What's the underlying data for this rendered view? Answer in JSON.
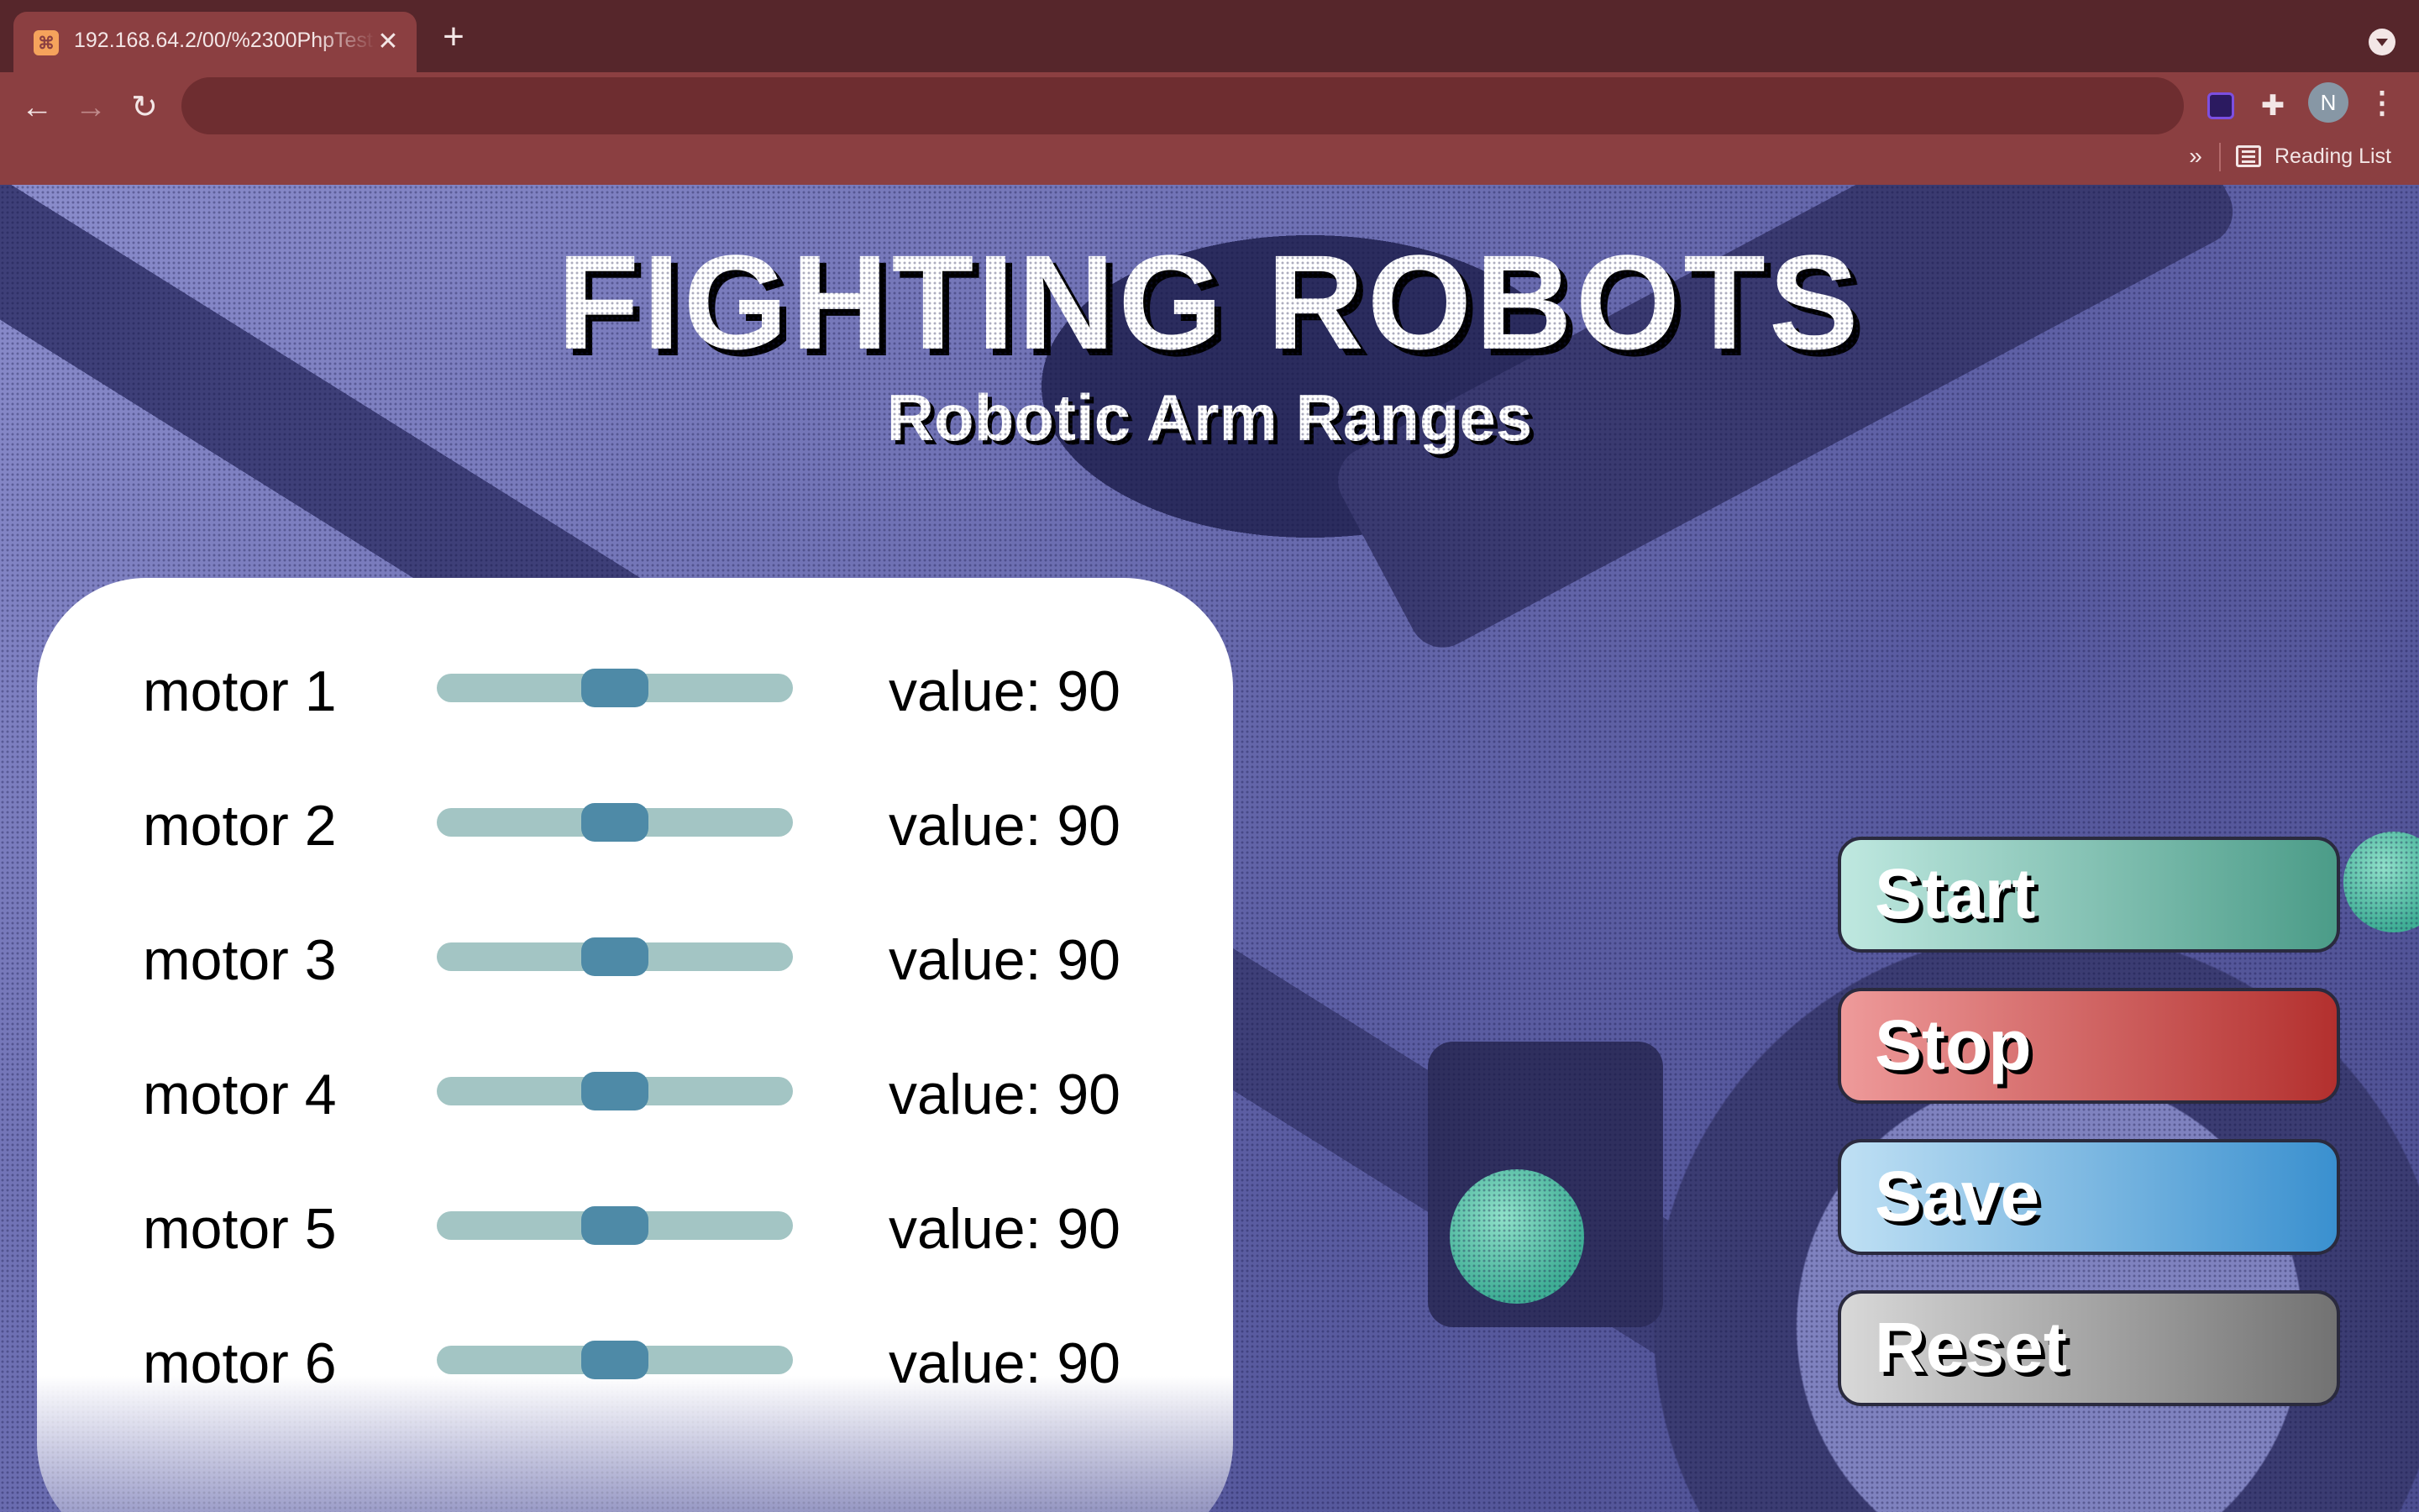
{
  "browser": {
    "tab_title": "192.168.64.2/00/%2300PhpTest",
    "tab_close": "✕",
    "new_tab": "+",
    "favicon_glyph": "⌘",
    "back": "←",
    "forward": "→",
    "reload": "↻",
    "address_value": "",
    "star": "☆",
    "puzzle": "✚",
    "avatar_letter": "N",
    "menu": "⋮",
    "bookmarks_overflow": "»",
    "reading_list_label": "Reading List"
  },
  "page": {
    "title": "FIGHTING ROBOTS",
    "subtitle": "Robotic Arm Ranges",
    "motors": [
      {
        "label": "motor 1",
        "value_text": "value: 90",
        "value": 90,
        "min": 0,
        "max": 180
      },
      {
        "label": "motor 2",
        "value_text": "value: 90",
        "value": 90,
        "min": 0,
        "max": 180
      },
      {
        "label": "motor 3",
        "value_text": "value: 90",
        "value": 90,
        "min": 0,
        "max": 180
      },
      {
        "label": "motor 4",
        "value_text": "value: 90",
        "value": 90,
        "min": 0,
        "max": 180
      },
      {
        "label": "motor 5",
        "value_text": "value: 90",
        "value": 90,
        "min": 0,
        "max": 180
      },
      {
        "label": "motor 6",
        "value_text": "value: 90",
        "value": 90,
        "min": 0,
        "max": 180
      }
    ],
    "buttons": {
      "start": "Start",
      "stop": "Stop",
      "save": "Save",
      "reset": "Reset"
    }
  },
  "colors": {
    "tabbar": "#56262b",
    "toolbar": "#8b3f41",
    "slider_track": "#a3c5c4",
    "slider_thumb": "#4e8aa7",
    "start": "#4b9c88",
    "stop": "#b3302e",
    "save": "#3a90cf",
    "reset": "#727272"
  },
  "icons": [
    "xampp-favicon-icon",
    "close-icon",
    "plus-icon",
    "back-arrow-icon",
    "forward-arrow-icon",
    "reload-icon",
    "star-icon",
    "extension-app-icon",
    "puzzle-icon",
    "kebab-menu-icon",
    "reading-list-icon",
    "tab-search-icon"
  ]
}
